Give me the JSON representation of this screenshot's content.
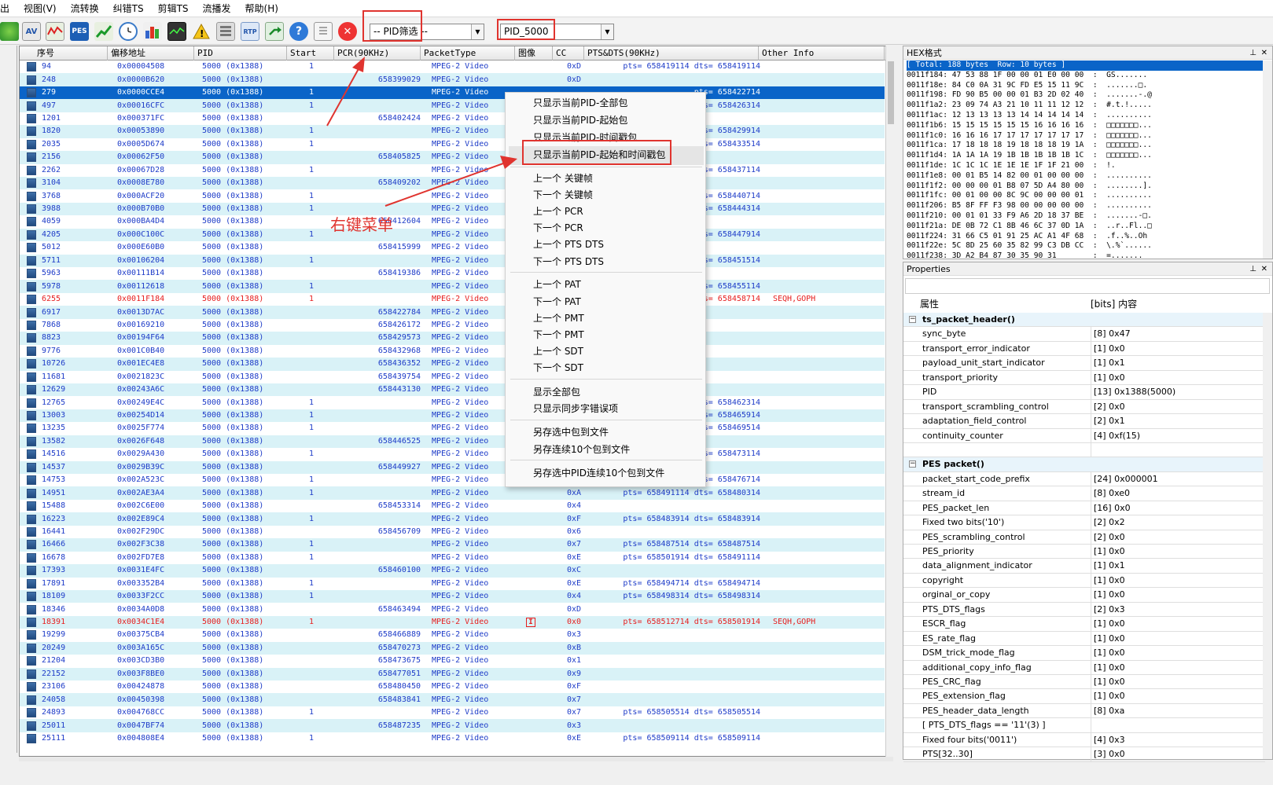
{
  "menu": [
    "出",
    "视图(V)",
    "流转换",
    "纠错TS",
    "剪辑TS",
    "流播发",
    "帮助(H)"
  ],
  "toolbar": {
    "icons": [
      "globe-icon",
      "av-icon",
      "waveform-icon",
      "pes-icon",
      "chart-up-icon",
      "clock-icon",
      "bar-chart-icon",
      "monitor-icon",
      "warning-icon",
      "keypad-icon",
      "rtp-icon",
      "export-icon",
      "help-icon",
      "list-icon",
      "close-icon"
    ],
    "pes_label": "PES",
    "av_label": "AV",
    "rtp_label": "RTP",
    "pid_filter_value": "-- PID筛选 --",
    "pid_select_value": "PID_5000"
  },
  "grid": {
    "columns": [
      "序号",
      "偏移地址",
      "PID",
      "Start",
      "PCR(90KHz)",
      "PacketType",
      "图像",
      "CC",
      "PTS&DTS(90KHz)",
      "Other Info"
    ],
    "rows": [
      {
        "n": "94",
        "off": "0x00004508",
        "pid": "5000 (0x1388)",
        "start": "1",
        "pcr": "",
        "type": "MPEG-2 Video",
        "img": "",
        "cc": "0xD",
        "pts": "pts= 658419114 dts= 658419114",
        "other": ""
      },
      {
        "n": "248",
        "off": "0x0000B620",
        "pid": "5000 (0x1388)",
        "start": "",
        "pcr": "658399029",
        "type": "MPEG-2 Video",
        "img": "",
        "cc": "0xD",
        "pts": "",
        "other": ""
      },
      {
        "n": "279",
        "off": "0x0000CCE4",
        "pid": "5000 (0x1388)",
        "start": "1",
        "pcr": "",
        "type": "MPEG-2 Video",
        "img": "",
        "cc": "",
        "pts": "pts= 658422714",
        "other": ""
      },
      {
        "n": "497",
        "off": "0x00016CFC",
        "pid": "5000 (0x1388)",
        "start": "1",
        "pcr": "",
        "type": "MPEG-2 Video",
        "img": "",
        "cc": "",
        "pts": "pts= 658426314",
        "other": ""
      },
      {
        "n": "1201",
        "off": "0x000371FC",
        "pid": "5000 (0x1388)",
        "start": "",
        "pcr": "658402424",
        "type": "MPEG-2 Video",
        "img": "",
        "cc": "",
        "pts": "",
        "other": ""
      },
      {
        "n": "1820",
        "off": "0x00053890",
        "pid": "5000 (0x1388)",
        "start": "1",
        "pcr": "",
        "type": "MPEG-2 Video",
        "img": "",
        "cc": "",
        "pts": "pts= 658429914",
        "other": ""
      },
      {
        "n": "2035",
        "off": "0x0005D674",
        "pid": "5000 (0x1388)",
        "start": "1",
        "pcr": "",
        "type": "MPEG-2 Video",
        "img": "",
        "cc": "",
        "pts": "pts= 658433514",
        "other": ""
      },
      {
        "n": "2156",
        "off": "0x00062F50",
        "pid": "5000 (0x1388)",
        "start": "",
        "pcr": "658405825",
        "type": "MPEG-2 Video",
        "img": "",
        "cc": "",
        "pts": "",
        "other": ""
      },
      {
        "n": "2262",
        "off": "0x00067D28",
        "pid": "5000 (0x1388)",
        "start": "1",
        "pcr": "",
        "type": "MPEG-2 Video",
        "img": "",
        "cc": "",
        "pts": "pts= 658437114",
        "other": ""
      },
      {
        "n": "3104",
        "off": "0x0008E780",
        "pid": "5000 (0x1388)",
        "start": "",
        "pcr": "658409202",
        "type": "MPEG-2 Video",
        "img": "",
        "cc": "",
        "pts": "",
        "other": ""
      },
      {
        "n": "3768",
        "off": "0x000ACF20",
        "pid": "5000 (0x1388)",
        "start": "1",
        "pcr": "",
        "type": "MPEG-2 Video",
        "img": "",
        "cc": "",
        "pts": "pts= 658440714",
        "other": ""
      },
      {
        "n": "3988",
        "off": "0x000B70B0",
        "pid": "5000 (0x1388)",
        "start": "1",
        "pcr": "",
        "type": "MPEG-2 Video",
        "img": "",
        "cc": "",
        "pts": "pts= 658444314",
        "other": ""
      },
      {
        "n": "4059",
        "off": "0x000BA4D4",
        "pid": "5000 (0x1388)",
        "start": "",
        "pcr": "658412604",
        "type": "MPEG-2 Video",
        "img": "",
        "cc": "",
        "pts": "",
        "other": ""
      },
      {
        "n": "4205",
        "off": "0x000C100C",
        "pid": "5000 (0x1388)",
        "start": "1",
        "pcr": "",
        "type": "MPEG-2 Video",
        "img": "",
        "cc": "",
        "pts": "pts= 658447914",
        "other": ""
      },
      {
        "n": "5012",
        "off": "0x000E60B0",
        "pid": "5000 (0x1388)",
        "start": "",
        "pcr": "658415999",
        "type": "MPEG-2 Video",
        "img": "",
        "cc": "",
        "pts": "",
        "other": ""
      },
      {
        "n": "5711",
        "off": "0x00106204",
        "pid": "5000 (0x1388)",
        "start": "1",
        "pcr": "",
        "type": "MPEG-2 Video",
        "img": "",
        "cc": "",
        "pts": "pts= 658451514",
        "other": ""
      },
      {
        "n": "5963",
        "off": "0x00111B14",
        "pid": "5000 (0x1388)",
        "start": "",
        "pcr": "658419386",
        "type": "MPEG-2 Video",
        "img": "",
        "cc": "",
        "pts": "",
        "other": ""
      },
      {
        "n": "5978",
        "off": "0x00112618",
        "pid": "5000 (0x1388)",
        "start": "1",
        "pcr": "",
        "type": "MPEG-2 Video",
        "img": "",
        "cc": "",
        "pts": "pts= 658455114",
        "other": ""
      },
      {
        "n": "6255",
        "off": "0x0011F184",
        "pid": "5000 (0x1388)",
        "start": "1",
        "pcr": "",
        "type": "MPEG-2 Video",
        "img": "",
        "cc": "",
        "pts": "pts= 658458714",
        "other": "SEQH,GOPH",
        "red": true
      },
      {
        "n": "6917",
        "off": "0x0013D7AC",
        "pid": "5000 (0x1388)",
        "start": "",
        "pcr": "658422784",
        "type": "MPEG-2 Video",
        "img": "",
        "cc": "",
        "pts": "",
        "other": ""
      },
      {
        "n": "7868",
        "off": "0x00169210",
        "pid": "5000 (0x1388)",
        "start": "",
        "pcr": "658426172",
        "type": "MPEG-2 Video",
        "img": "",
        "cc": "",
        "pts": "",
        "other": ""
      },
      {
        "n": "8823",
        "off": "0x00194F64",
        "pid": "5000 (0x1388)",
        "start": "",
        "pcr": "658429573",
        "type": "MPEG-2 Video",
        "img": "",
        "cc": "",
        "pts": "",
        "other": ""
      },
      {
        "n": "9776",
        "off": "0x001C0B40",
        "pid": "5000 (0x1388)",
        "start": "",
        "pcr": "658432968",
        "type": "MPEG-2 Video",
        "img": "",
        "cc": "",
        "pts": "",
        "other": ""
      },
      {
        "n": "10726",
        "off": "0x001EC4E8",
        "pid": "5000 (0x1388)",
        "start": "",
        "pcr": "658436352",
        "type": "MPEG-2 Video",
        "img": "",
        "cc": "",
        "pts": "",
        "other": ""
      },
      {
        "n": "11681",
        "off": "0x0021823C",
        "pid": "5000 (0x1388)",
        "start": "",
        "pcr": "658439754",
        "type": "MPEG-2 Video",
        "img": "",
        "cc": "",
        "pts": "",
        "other": ""
      },
      {
        "n": "12629",
        "off": "0x00243A6C",
        "pid": "5000 (0x1388)",
        "start": "",
        "pcr": "658443130",
        "type": "MPEG-2 Video",
        "img": "",
        "cc": "",
        "pts": "",
        "other": ""
      },
      {
        "n": "12765",
        "off": "0x00249E4C",
        "pid": "5000 (0x1388)",
        "start": "1",
        "pcr": "",
        "type": "MPEG-2 Video",
        "img": "",
        "cc": "",
        "pts": "pts= 658462314",
        "other": ""
      },
      {
        "n": "13003",
        "off": "0x00254D14",
        "pid": "5000 (0x1388)",
        "start": "1",
        "pcr": "",
        "type": "MPEG-2 Video",
        "img": "",
        "cc": "",
        "pts": "pts= 658465914",
        "other": ""
      },
      {
        "n": "13235",
        "off": "0x0025F774",
        "pid": "5000 (0x1388)",
        "start": "1",
        "pcr": "",
        "type": "MPEG-2 Video",
        "img": "",
        "cc": "",
        "pts": "pts= 658469514",
        "other": ""
      },
      {
        "n": "13582",
        "off": "0x0026F648",
        "pid": "5000 (0x1388)",
        "start": "",
        "pcr": "658446525",
        "type": "MPEG-2 Video",
        "img": "",
        "cc": "",
        "pts": "",
        "other": ""
      },
      {
        "n": "14516",
        "off": "0x0029A430",
        "pid": "5000 (0x1388)",
        "start": "1",
        "pcr": "",
        "type": "MPEG-2 Video",
        "img": "",
        "cc": "",
        "pts": "pts= 658473114",
        "other": ""
      },
      {
        "n": "14537",
        "off": "0x0029B39C",
        "pid": "5000 (0x1388)",
        "start": "",
        "pcr": "658449927",
        "type": "MPEG-2 Video",
        "img": "",
        "cc": "",
        "pts": "",
        "other": ""
      },
      {
        "n": "14753",
        "off": "0x002A523C",
        "pid": "5000 (0x1388)",
        "start": "1",
        "pcr": "",
        "type": "MPEG-2 Video",
        "img": "",
        "cc": "",
        "pts": "pts= 658476714",
        "other": ""
      },
      {
        "n": "14951",
        "off": "0x002AE3A4",
        "pid": "5000 (0x1388)",
        "start": "1",
        "pcr": "",
        "type": "MPEG-2 Video",
        "img": "",
        "cc": "0xA",
        "pts": "pts= 658491114 dts= 658480314",
        "other": ""
      },
      {
        "n": "15488",
        "off": "0x002C6E00",
        "pid": "5000 (0x1388)",
        "start": "",
        "pcr": "658453314",
        "type": "MPEG-2 Video",
        "img": "",
        "cc": "0x4",
        "pts": "",
        "other": ""
      },
      {
        "n": "16223",
        "off": "0x002E89C4",
        "pid": "5000 (0x1388)",
        "start": "1",
        "pcr": "",
        "type": "MPEG-2 Video",
        "img": "",
        "cc": "0xF",
        "pts": "pts= 658483914 dts= 658483914",
        "other": ""
      },
      {
        "n": "16441",
        "off": "0x002F29DC",
        "pid": "5000 (0x1388)",
        "start": "",
        "pcr": "658456709",
        "type": "MPEG-2 Video",
        "img": "",
        "cc": "0x6",
        "pts": "",
        "other": ""
      },
      {
        "n": "16466",
        "off": "0x002F3C38",
        "pid": "5000 (0x1388)",
        "start": "1",
        "pcr": "",
        "type": "MPEG-2 Video",
        "img": "",
        "cc": "0x7",
        "pts": "pts= 658487514 dts= 658487514",
        "other": ""
      },
      {
        "n": "16678",
        "off": "0x002FD7E8",
        "pid": "5000 (0x1388)",
        "start": "1",
        "pcr": "",
        "type": "MPEG-2 Video",
        "img": "",
        "cc": "0xE",
        "pts": "pts= 658501914 dts= 658491114",
        "other": ""
      },
      {
        "n": "17393",
        "off": "0x0031E4FC",
        "pid": "5000 (0x1388)",
        "start": "",
        "pcr": "658460100",
        "type": "MPEG-2 Video",
        "img": "",
        "cc": "0xC",
        "pts": "",
        "other": ""
      },
      {
        "n": "17891",
        "off": "0x003352B4",
        "pid": "5000 (0x1388)",
        "start": "1",
        "pcr": "",
        "type": "MPEG-2 Video",
        "img": "",
        "cc": "0xE",
        "pts": "pts= 658494714 dts= 658494714",
        "other": ""
      },
      {
        "n": "18109",
        "off": "0x0033F2CC",
        "pid": "5000 (0x1388)",
        "start": "1",
        "pcr": "",
        "type": "MPEG-2 Video",
        "img": "",
        "cc": "0x4",
        "pts": "pts= 658498314 dts= 658498314",
        "other": ""
      },
      {
        "n": "18346",
        "off": "0x0034A0D8",
        "pid": "5000 (0x1388)",
        "start": "",
        "pcr": "658463494",
        "type": "MPEG-2 Video",
        "img": "",
        "cc": "0xD",
        "pts": "",
        "other": ""
      },
      {
        "n": "18391",
        "off": "0x0034C1E4",
        "pid": "5000 (0x1388)",
        "start": "1",
        "pcr": "",
        "type": "MPEG-2 Video",
        "img": "I",
        "cc": "0x0",
        "pts": "pts= 658512714 dts= 658501914",
        "other": "SEQH,GOPH",
        "red": true
      },
      {
        "n": "19299",
        "off": "0x00375CB4",
        "pid": "5000 (0x1388)",
        "start": "",
        "pcr": "658466889",
        "type": "MPEG-2 Video",
        "img": "",
        "cc": "0x3",
        "pts": "",
        "other": ""
      },
      {
        "n": "20249",
        "off": "0x003A165C",
        "pid": "5000 (0x1388)",
        "start": "",
        "pcr": "658470273",
        "type": "MPEG-2 Video",
        "img": "",
        "cc": "0xB",
        "pts": "",
        "other": ""
      },
      {
        "n": "21204",
        "off": "0x003CD3B0",
        "pid": "5000 (0x1388)",
        "start": "",
        "pcr": "658473675",
        "type": "MPEG-2 Video",
        "img": "",
        "cc": "0x1",
        "pts": "",
        "other": ""
      },
      {
        "n": "22152",
        "off": "0x003F8BE0",
        "pid": "5000 (0x1388)",
        "start": "",
        "pcr": "658477051",
        "type": "MPEG-2 Video",
        "img": "",
        "cc": "0x9",
        "pts": "",
        "other": ""
      },
      {
        "n": "23106",
        "off": "0x00424878",
        "pid": "5000 (0x1388)",
        "start": "",
        "pcr": "658480450",
        "type": "MPEG-2 Video",
        "img": "",
        "cc": "0xF",
        "pts": "",
        "other": ""
      },
      {
        "n": "24058",
        "off": "0x00450398",
        "pid": "5000 (0x1388)",
        "start": "",
        "pcr": "658483841",
        "type": "MPEG-2 Video",
        "img": "",
        "cc": "0x7",
        "pts": "",
        "other": ""
      },
      {
        "n": "24893",
        "off": "0x004768CC",
        "pid": "5000 (0x1388)",
        "start": "1",
        "pcr": "",
        "type": "MPEG-2 Video",
        "img": "",
        "cc": "0x7",
        "pts": "pts= 658505514 dts= 658505514",
        "other": ""
      },
      {
        "n": "25011",
        "off": "0x0047BF74",
        "pid": "5000 (0x1388)",
        "start": "",
        "pcr": "658487235",
        "type": "MPEG-2 Video",
        "img": "",
        "cc": "0x3",
        "pts": "",
        "other": ""
      },
      {
        "n": "25111",
        "off": "0x004808E4",
        "pid": "5000 (0x1388)",
        "start": "1",
        "pcr": "",
        "type": "MPEG-2 Video",
        "img": "",
        "cc": "0xE",
        "pts": "pts= 658509114 dts= 658509114",
        "other": ""
      }
    ]
  },
  "context_menu": {
    "items": [
      "只显示当前PID-全部包",
      "只显示当前PID-起始包",
      "只显示当前PID-时间戳包",
      "只显示当前PID-起始和时间戳包",
      "上一个 关键帧",
      "下一个 关键帧",
      "上一个 PCR",
      "下一个 PCR",
      "上一个 PTS DTS",
      "下一个 PTS DTS",
      "上一个 PAT",
      "下一个 PAT",
      "上一个 PMT",
      "下一个 PMT",
      "上一个 SDT",
      "下一个 SDT",
      "显示全部包",
      "只显示同步字错误项",
      "另存选中包到文件",
      "另存连续10个包到文件",
      "另存选中PID连续10个包到文件"
    ]
  },
  "annotation": "右键菜单",
  "hex": {
    "title": "HEX格式",
    "summary": "[ Total: 188 bytes  Row: 10 bytes ]",
    "lines": [
      "0011f184: 47 53 88 1F 00 00 01 E0 00 00  :  GS.......",
      "0011f18e: 84 C0 0A 31 9C FD E5 15 11 9C  :  .......□.",
      "0011f198: FD 90 B5 00 00 01 B3 2D 02 40  :  .......-.@",
      "0011f1a2: 23 09 74 A3 21 10 11 11 12 12  :  #.t.!.....",
      "0011f1ac: 12 13 13 13 13 14 14 14 14 14  :  ..........",
      "0011f1b6: 15 15 15 15 15 15 16 16 16 16  :  □□□□□□□...",
      "0011f1c0: 16 16 16 17 17 17 17 17 17 17  :  □□□□□□□...",
      "0011f1ca: 17 18 18 18 19 18 18 18 19 1A  :  □□□□□□□...",
      "0011f1d4: 1A 1A 1A 19 1B 1B 1B 1B 1B 1C  :  □□□□□□□...",
      "0011f1de: 1C 1C 1C 1E 1E 1E 1F 1F 21 00  :  !.",
      "0011f1e8: 00 01 B5 14 82 00 01 00 00 00  :  ..........",
      "0011f1f2: 00 00 00 01 B8 07 5D A4 80 00  :  ........].",
      "0011f1fc: 00 01 00 00 8C 9C 00 00 00 01  :  ..........",
      "0011f206: B5 8F FF F3 98 00 00 00 00 00  :  ..........",
      "0011f210: 00 01 01 33 F9 A6 2D 18 37 BE  :  .......-□.",
      "0011f21a: DE 0B 72 C1 8B 46 6C 37 0D 1A  :  ..r..Fl..□",
      "0011f224: 31 66 C5 01 91 25 AC A1 4F 68  :  .f..%..Oh",
      "0011f22e: 5C 8D 25 60 35 82 99 C3 DB CC  :  \\.%`......",
      "0011f238: 3D A2 B4 87 30 35 90 31        :  =......."
    ]
  },
  "properties": {
    "title": "Properties",
    "col_name": "属性",
    "col_value": "[bits] 内容",
    "rows": [
      {
        "group": true,
        "k": "ts_packet_header()",
        "v": ""
      },
      {
        "k": "sync_byte",
        "v": "[8] 0x47"
      },
      {
        "k": "transport_error_indicator",
        "v": "[1] 0x0"
      },
      {
        "k": "payload_unit_start_indicator",
        "v": "[1] 0x1"
      },
      {
        "k": "transport_priority",
        "v": "[1] 0x0"
      },
      {
        "k": "PID",
        "v": "[13] 0x1388(5000)"
      },
      {
        "k": "transport_scrambling_control",
        "v": "[2] 0x0"
      },
      {
        "k": "adaptation_field_control",
        "v": "[2] 0x1"
      },
      {
        "k": "continuity_counter",
        "v": "[4] 0xf(15)"
      },
      {
        "k": "",
        "v": ""
      },
      {
        "group": true,
        "k": "PES packet()",
        "v": ""
      },
      {
        "k": "packet_start_code_prefix",
        "v": "[24] 0x000001"
      },
      {
        "k": "stream_id",
        "v": "[8] 0xe0"
      },
      {
        "k": "PES_packet_len",
        "v": "[16] 0x0"
      },
      {
        "k": "Fixed two bits('10')",
        "v": "[2] 0x2"
      },
      {
        "k": "PES_scrambling_control",
        "v": "[2] 0x0"
      },
      {
        "k": "PES_priority",
        "v": "[1] 0x0"
      },
      {
        "k": "data_alignment_indicator",
        "v": "[1] 0x1"
      },
      {
        "k": "copyright",
        "v": "[1] 0x0"
      },
      {
        "k": "orginal_or_copy",
        "v": "[1] 0x0"
      },
      {
        "k": "PTS_DTS_flags",
        "v": "[2] 0x3"
      },
      {
        "k": "ESCR_flag",
        "v": "[1] 0x0"
      },
      {
        "k": "ES_rate_flag",
        "v": "[1] 0x0"
      },
      {
        "k": "DSM_trick_mode_flag",
        "v": "[1] 0x0"
      },
      {
        "k": "additional_copy_info_flag",
        "v": "[1] 0x0"
      },
      {
        "k": "PES_CRC_flag",
        "v": "[1] 0x0"
      },
      {
        "k": "PES_extension_flag",
        "v": "[1] 0x0"
      },
      {
        "k": "PES_header_data_length",
        "v": "[8] 0xa"
      },
      {
        "k": "[ PTS_DTS_flags == '11'(3) ]",
        "v": ""
      },
      {
        "k": " Fixed four bits('0011')",
        "v": "[4] 0x3"
      },
      {
        "k": " PTS[32..30]",
        "v": "[3] 0x0"
      }
    ]
  },
  "colors": {
    "accent": "#0a64c8",
    "alt_row": "#d9f2f7",
    "annotation_red": "#e0342f",
    "text_blue": "#1e3cc8"
  }
}
